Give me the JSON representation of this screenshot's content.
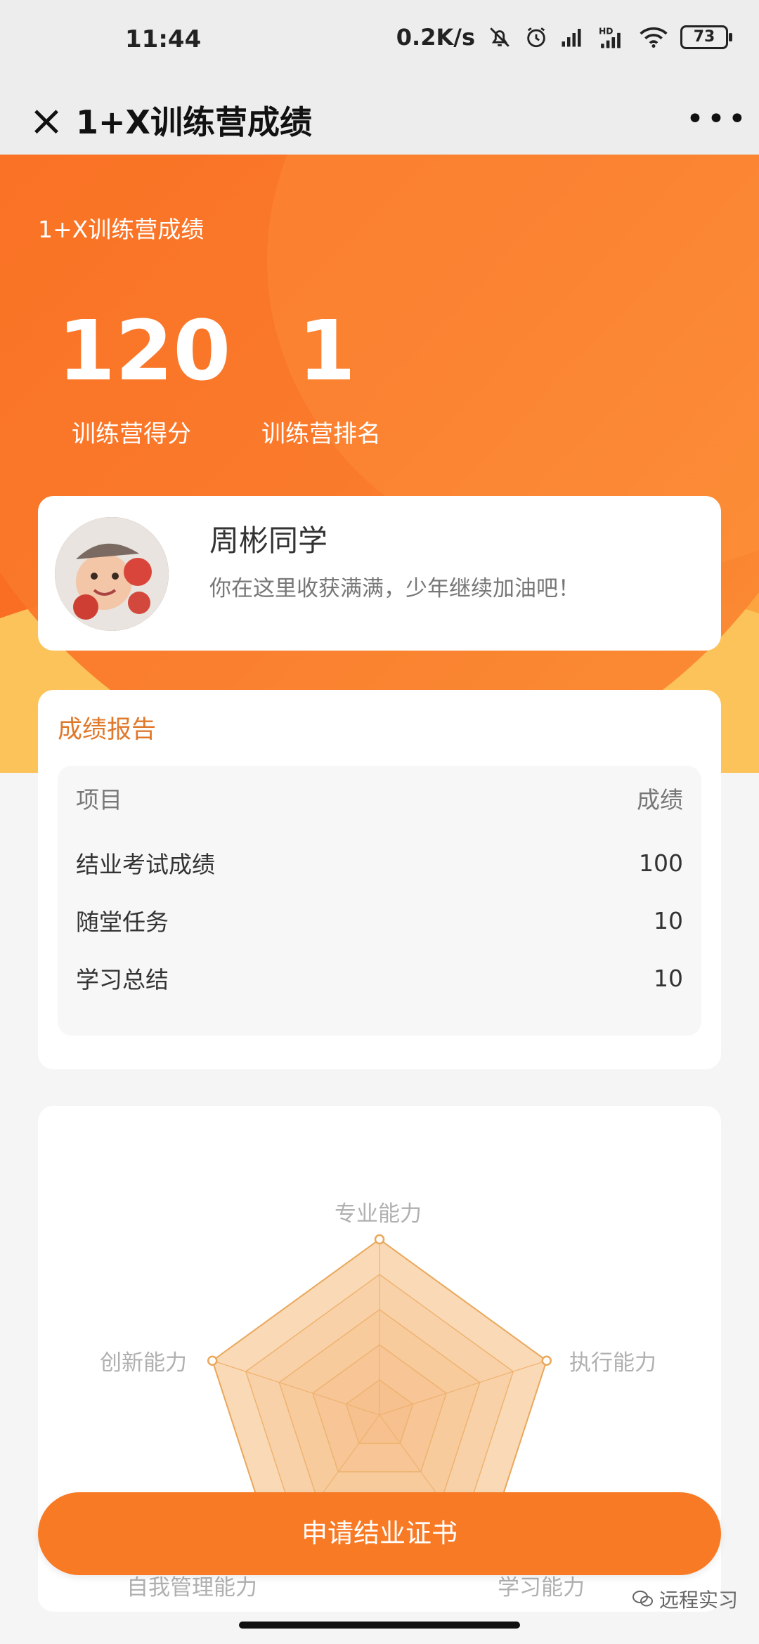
{
  "status_bar": {
    "time": "11:44",
    "net_speed": "0.2K/s",
    "battery": "73",
    "icons": [
      "bell-off-icon",
      "alarm-icon",
      "signal-icon",
      "hd-signal-icon",
      "wifi-icon",
      "battery-icon"
    ]
  },
  "titlebar": {
    "title": "1+X训练营成绩",
    "close_icon": "×",
    "more_icon": "•••"
  },
  "hero": {
    "subtitle": "1+X训练营成绩",
    "score": "120",
    "score_label": "训练营得分",
    "rank": "1",
    "rank_label": "训练营排名"
  },
  "profile": {
    "name": "周彬同学",
    "message": "你在这里收获满满，少年继续加油吧！"
  },
  "report": {
    "title": "成绩报告",
    "header": {
      "item": "项目",
      "score": "成绩"
    },
    "rows": [
      {
        "item": "结业考试成绩",
        "score": "100"
      },
      {
        "item": "随堂任务",
        "score": "10"
      },
      {
        "item": "学习总结",
        "score": "10"
      }
    ]
  },
  "radar": {
    "labels": [
      "专业能力",
      "执行能力",
      "学习能力",
      "自我管理能力",
      "创新能力"
    ],
    "values": [
      1,
      1,
      1,
      1,
      1
    ],
    "levels": 5,
    "fill_color": "#f9c996",
    "stroke_color": "#e9a85c"
  },
  "cta": {
    "label": "申请结业证书"
  },
  "watermark": {
    "text": "远程实习"
  }
}
